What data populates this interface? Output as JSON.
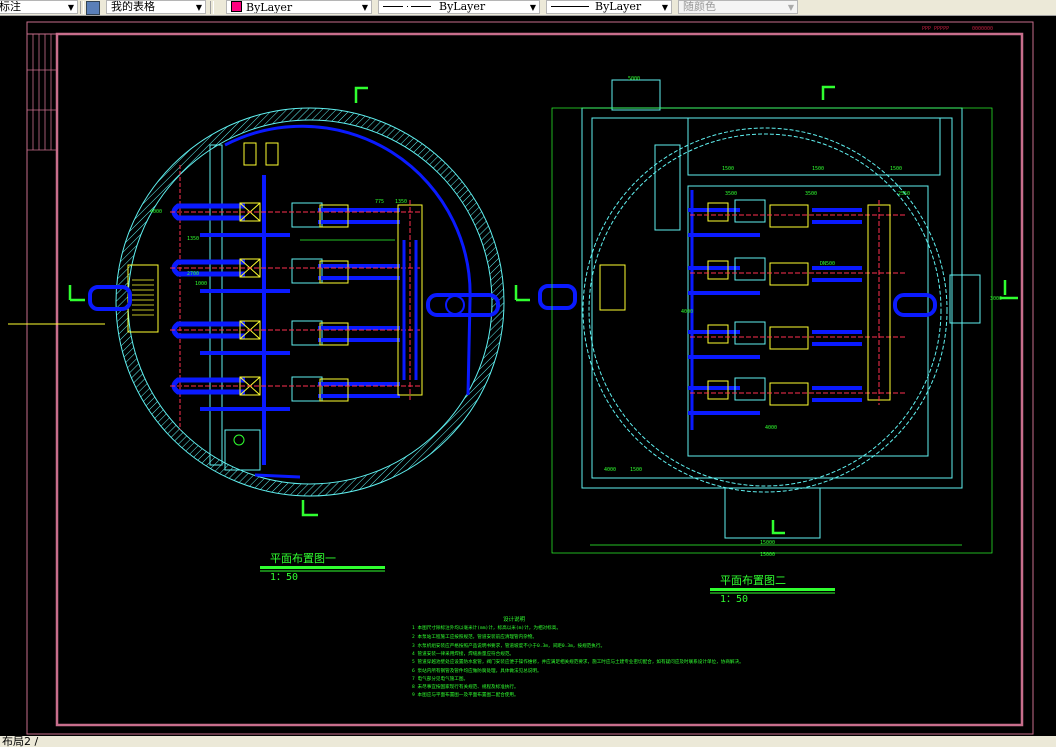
{
  "toolbar": {
    "dim_style": "标注",
    "table_style": "我的表格",
    "color": "ByLayer",
    "linetype": "ByLayer",
    "lineweight": "ByLayer",
    "plot_style": "随颜色"
  },
  "title_block": {
    "label_a": "PPP PPPPP",
    "label_b": "0000000"
  },
  "plan1": {
    "title": "平面布置图一",
    "scale": "1：50",
    "dims": [
      "4000",
      "775",
      "1350",
      "2700",
      "1350",
      "1000"
    ]
  },
  "plan2": {
    "title": "平面布置图二",
    "scale": "1：50",
    "dims": [
      "5000",
      "1500",
      "1500",
      "1500",
      "3500",
      "3500",
      "2550",
      "DN500",
      "4000",
      "4000",
      "15000",
      "15000",
      "4000",
      "1500",
      "3000"
    ]
  },
  "notes": {
    "title": "设计说明",
    "items": [
      "1 本图尺寸除标注外均以毫米计(mm)计，标高以米(m)计，为相对标高。",
      "2 本泵站工程施工应按照规范，管道安装前应清理管内杂物。",
      "3 水泵机组安装应严格按照产品说明书要求，管道坡度不小于0.3m，间距0.3m，按规范执行。",
      "4 管道安装一律采用焊接，焊缝质量应符合规范。",
      "5 管道穿越池壁处应设置防水套管，阀门安装应便于操作维修，并应满足相关规范要求，施工时应与土建专业密切配合，如有疑问应及时联系设计单位，协商解决。",
      "6 泵站内所有钢管及管件均应做防腐处理，具体做法见总说明。",
      "7 电气部分见电气施工图。",
      "8 未尽事宜按国家现行有关规范、规程及标准执行。",
      "9 本图应与平面布置图一及平面布置图二配合使用。"
    ]
  },
  "status": {
    "layout_tab": "布局2 /"
  },
  "colors": {
    "frame": "#c86e8c",
    "cyan": "#5ff0f0",
    "blue": "#0a1aff",
    "yellow": "#ffff30",
    "green": "#30ff30",
    "red": "#ff3050"
  }
}
